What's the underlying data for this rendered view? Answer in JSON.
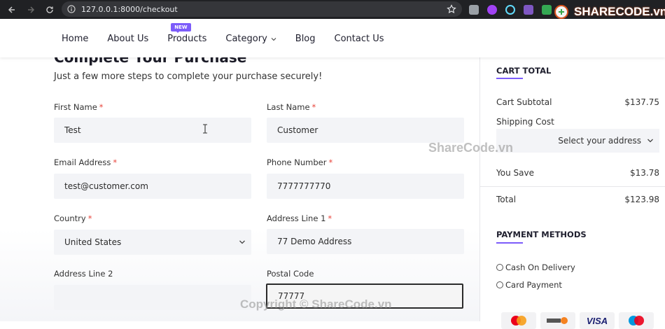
{
  "browser": {
    "url": "127.0.0.1:8000/checkout"
  },
  "watermark": {
    "logo_text": "SHARECODE.vn",
    "center_text": "ShareCode.vn",
    "bottom_text": "Copyright © ShareCode.vn"
  },
  "nav": {
    "items": [
      {
        "label": "Home"
      },
      {
        "label": "About Us"
      },
      {
        "label": "Products",
        "badge": "NEW"
      },
      {
        "label": "Category"
      },
      {
        "label": "Blog"
      },
      {
        "label": "Contact Us"
      }
    ]
  },
  "checkout": {
    "title": "Complete Your Purchase",
    "subtitle": "Just a few more steps to complete your purchase securely!",
    "required_mark": "*",
    "fields": {
      "first_name": {
        "label": "First Name",
        "value": "Test"
      },
      "last_name": {
        "label": "Last Name",
        "value": "Customer"
      },
      "email": {
        "label": "Email Address",
        "value": "test@customer.com"
      },
      "phone": {
        "label": "Phone Number",
        "value": "7777777770"
      },
      "country": {
        "label": "Country",
        "value": "United States"
      },
      "address1": {
        "label": "Address Line 1",
        "value": "77 Demo Address"
      },
      "address2": {
        "label": "Address Line 2",
        "value": ""
      },
      "postal": {
        "label": "Postal Code",
        "value": "77777"
      }
    }
  },
  "cart": {
    "heading": "CART TOTAL",
    "subtotal_label": "Cart Subtotal",
    "subtotal_value": "$137.75",
    "shipping_label": "Shipping Cost",
    "shipping_select": "Select your address",
    "save_label": "You Save",
    "save_value": "$13.78",
    "total_label": "Total",
    "total_value": "$123.98"
  },
  "payment": {
    "heading": "PAYMENT METHODS",
    "options": [
      "Cash On Delivery",
      "Card Payment"
    ],
    "cards": [
      "mastercard",
      "discover",
      "VISA",
      "maestro"
    ]
  },
  "colors": {
    "accent": "#7c5cfa",
    "required": "#e8453c"
  }
}
